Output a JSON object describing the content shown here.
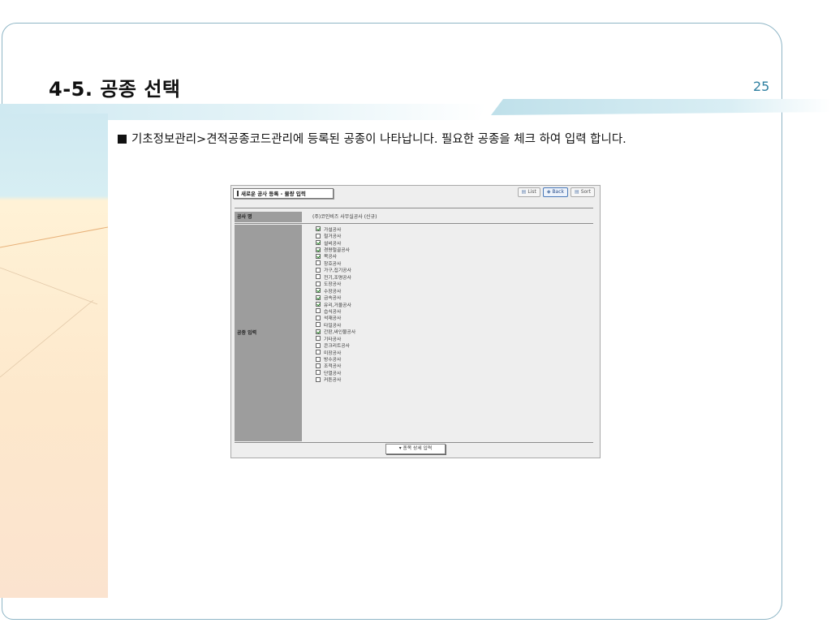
{
  "slide": {
    "title": "4-5. 공종 선택",
    "page_number": "25",
    "instruction": "기초정보관리>견적공종코드관리에 등록된 공종이 나타납니다. 필요한 공종을 체크 하여 입력 합니다."
  },
  "app": {
    "title": "새로운 공사 등록 - 물량 입력",
    "buttons": [
      {
        "label": "List",
        "icon": "list-icon",
        "active": false
      },
      {
        "label": "Back",
        "icon": "back-icon",
        "active": true
      },
      {
        "label": "Sort",
        "icon": "sort-icon",
        "active": false
      }
    ],
    "project_label": "공사 명",
    "project_name": "(주)코인비즈 사무실공사 (신규)",
    "trade_label": "공종 입력",
    "trades": [
      {
        "label": "가설공사",
        "checked": true
      },
      {
        "label": "철거공사",
        "checked": false
      },
      {
        "label": "설비공사",
        "checked": true
      },
      {
        "label": "경량철골공사",
        "checked": true
      },
      {
        "label": "목공사",
        "checked": true
      },
      {
        "label": "창호공사",
        "checked": false
      },
      {
        "label": "가구,집기공사",
        "checked": false
      },
      {
        "label": "전기,조명공사",
        "checked": false
      },
      {
        "label": "도장공사",
        "checked": false
      },
      {
        "label": "수장공사",
        "checked": true
      },
      {
        "label": "금속공사",
        "checked": true
      },
      {
        "label": "유리,거울공사",
        "checked": true
      },
      {
        "label": "습식공사",
        "checked": false
      },
      {
        "label": "석재공사",
        "checked": false
      },
      {
        "label": "타일공사",
        "checked": false
      },
      {
        "label": "간판,싸인물공사",
        "checked": true
      },
      {
        "label": "기타공사",
        "checked": false
      },
      {
        "label": "콘크리트공사",
        "checked": false
      },
      {
        "label": "미장공사",
        "checked": false
      },
      {
        "label": "방수공사",
        "checked": false
      },
      {
        "label": "조적공사",
        "checked": false
      },
      {
        "label": "단열공사",
        "checked": false
      },
      {
        "label": "커튼공사",
        "checked": false
      }
    ],
    "detail_button": "종목 상세 입력"
  },
  "colors": {
    "frame": "#8fb6c6",
    "page_number": "#2e7fa0",
    "label_bg": "#9d9d9d",
    "panel_bg": "#eeeeee"
  }
}
